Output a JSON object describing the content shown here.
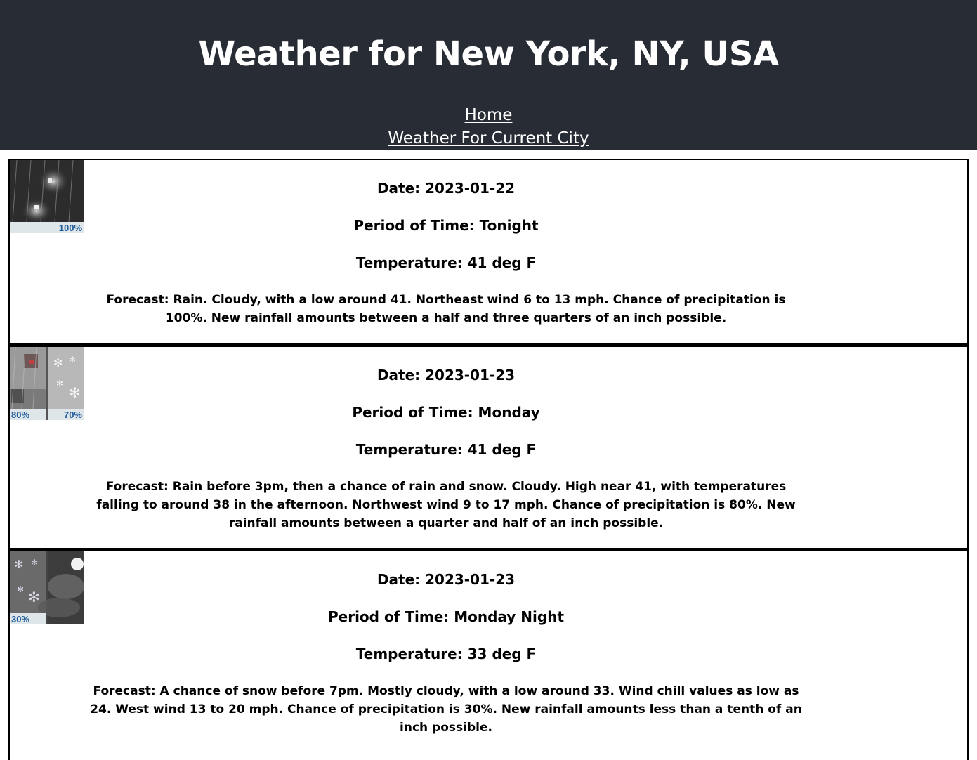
{
  "header": {
    "title": "Weather for New York, NY, USA",
    "nav": [
      {
        "label": "Home"
      },
      {
        "label": "Weather For Current City"
      }
    ]
  },
  "periods": [
    {
      "date_text": "Date: 2023-01-22",
      "period_text": "Period of Time: Tonight",
      "temp_text": "Temperature: 41 deg F",
      "forecast_text": "Forecast: Rain. Cloudy, with a low around 41. Northeast wind 6 to 13 mph. Chance of precipitation is 100%. New rainfall amounts between a half and three quarters of an inch possible.",
      "icon": {
        "name": "rain-icon",
        "left_pct": "",
        "right_pct": "100%"
      }
    },
    {
      "date_text": "Date: 2023-01-23",
      "period_text": "Period of Time: Monday",
      "temp_text": "Temperature: 41 deg F",
      "forecast_text": "Forecast: Rain before 3pm, then a chance of rain and snow. Cloudy. High near 41, with temperatures falling to around 38 in the afternoon. Northwest wind 9 to 17 mph. Chance of precipitation is 80%. New rainfall amounts between a quarter and half of an inch possible.",
      "icon": {
        "name": "rain-snow-icon",
        "left_pct": "80%",
        "right_pct": "70%"
      }
    },
    {
      "date_text": "Date: 2023-01-23",
      "period_text": "Period of Time: Monday Night",
      "temp_text": "Temperature: 33 deg F",
      "forecast_text": "Forecast: A chance of snow before 7pm. Mostly cloudy, with a low around 33. Wind chill values as low as 24. West wind 13 to 20 mph. Chance of precipitation is 30%. New rainfall amounts less than a tenth of an inch possible.",
      "icon": {
        "name": "snow-cloudy-night-icon",
        "left_pct": "30%",
        "right_pct": ""
      }
    }
  ]
}
